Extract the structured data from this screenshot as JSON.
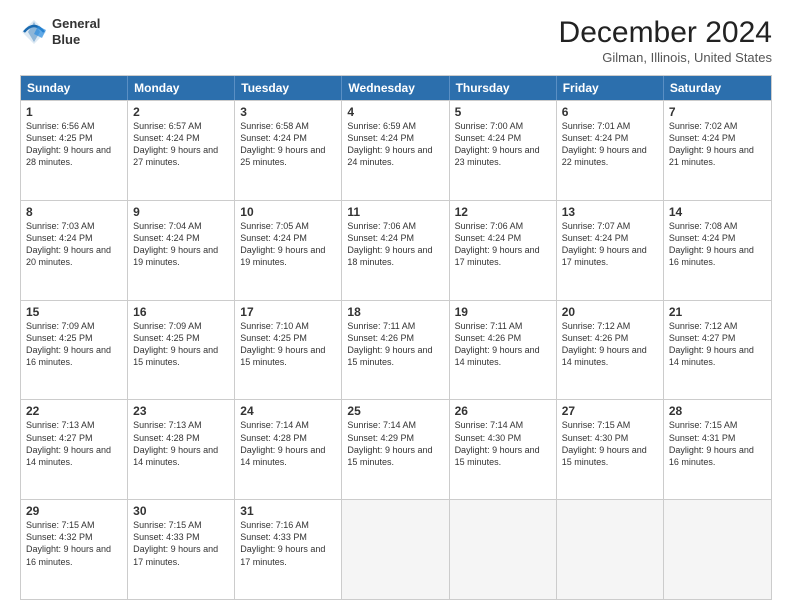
{
  "logo": {
    "line1": "General",
    "line2": "Blue"
  },
  "title": "December 2024",
  "subtitle": "Gilman, Illinois, United States",
  "days": [
    "Sunday",
    "Monday",
    "Tuesday",
    "Wednesday",
    "Thursday",
    "Friday",
    "Saturday"
  ],
  "rows": [
    [
      {
        "num": "1",
        "text": "Sunrise: 6:56 AM\nSunset: 4:25 PM\nDaylight: 9 hours and 28 minutes."
      },
      {
        "num": "2",
        "text": "Sunrise: 6:57 AM\nSunset: 4:24 PM\nDaylight: 9 hours and 27 minutes."
      },
      {
        "num": "3",
        "text": "Sunrise: 6:58 AM\nSunset: 4:24 PM\nDaylight: 9 hours and 25 minutes."
      },
      {
        "num": "4",
        "text": "Sunrise: 6:59 AM\nSunset: 4:24 PM\nDaylight: 9 hours and 24 minutes."
      },
      {
        "num": "5",
        "text": "Sunrise: 7:00 AM\nSunset: 4:24 PM\nDaylight: 9 hours and 23 minutes."
      },
      {
        "num": "6",
        "text": "Sunrise: 7:01 AM\nSunset: 4:24 PM\nDaylight: 9 hours and 22 minutes."
      },
      {
        "num": "7",
        "text": "Sunrise: 7:02 AM\nSunset: 4:24 PM\nDaylight: 9 hours and 21 minutes."
      }
    ],
    [
      {
        "num": "8",
        "text": "Sunrise: 7:03 AM\nSunset: 4:24 PM\nDaylight: 9 hours and 20 minutes."
      },
      {
        "num": "9",
        "text": "Sunrise: 7:04 AM\nSunset: 4:24 PM\nDaylight: 9 hours and 19 minutes."
      },
      {
        "num": "10",
        "text": "Sunrise: 7:05 AM\nSunset: 4:24 PM\nDaylight: 9 hours and 19 minutes."
      },
      {
        "num": "11",
        "text": "Sunrise: 7:06 AM\nSunset: 4:24 PM\nDaylight: 9 hours and 18 minutes."
      },
      {
        "num": "12",
        "text": "Sunrise: 7:06 AM\nSunset: 4:24 PM\nDaylight: 9 hours and 17 minutes."
      },
      {
        "num": "13",
        "text": "Sunrise: 7:07 AM\nSunset: 4:24 PM\nDaylight: 9 hours and 17 minutes."
      },
      {
        "num": "14",
        "text": "Sunrise: 7:08 AM\nSunset: 4:24 PM\nDaylight: 9 hours and 16 minutes."
      }
    ],
    [
      {
        "num": "15",
        "text": "Sunrise: 7:09 AM\nSunset: 4:25 PM\nDaylight: 9 hours and 16 minutes."
      },
      {
        "num": "16",
        "text": "Sunrise: 7:09 AM\nSunset: 4:25 PM\nDaylight: 9 hours and 15 minutes."
      },
      {
        "num": "17",
        "text": "Sunrise: 7:10 AM\nSunset: 4:25 PM\nDaylight: 9 hours and 15 minutes."
      },
      {
        "num": "18",
        "text": "Sunrise: 7:11 AM\nSunset: 4:26 PM\nDaylight: 9 hours and 15 minutes."
      },
      {
        "num": "19",
        "text": "Sunrise: 7:11 AM\nSunset: 4:26 PM\nDaylight: 9 hours and 14 minutes."
      },
      {
        "num": "20",
        "text": "Sunrise: 7:12 AM\nSunset: 4:26 PM\nDaylight: 9 hours and 14 minutes."
      },
      {
        "num": "21",
        "text": "Sunrise: 7:12 AM\nSunset: 4:27 PM\nDaylight: 9 hours and 14 minutes."
      }
    ],
    [
      {
        "num": "22",
        "text": "Sunrise: 7:13 AM\nSunset: 4:27 PM\nDaylight: 9 hours and 14 minutes."
      },
      {
        "num": "23",
        "text": "Sunrise: 7:13 AM\nSunset: 4:28 PM\nDaylight: 9 hours and 14 minutes."
      },
      {
        "num": "24",
        "text": "Sunrise: 7:14 AM\nSunset: 4:28 PM\nDaylight: 9 hours and 14 minutes."
      },
      {
        "num": "25",
        "text": "Sunrise: 7:14 AM\nSunset: 4:29 PM\nDaylight: 9 hours and 15 minutes."
      },
      {
        "num": "26",
        "text": "Sunrise: 7:14 AM\nSunset: 4:30 PM\nDaylight: 9 hours and 15 minutes."
      },
      {
        "num": "27",
        "text": "Sunrise: 7:15 AM\nSunset: 4:30 PM\nDaylight: 9 hours and 15 minutes."
      },
      {
        "num": "28",
        "text": "Sunrise: 7:15 AM\nSunset: 4:31 PM\nDaylight: 9 hours and 16 minutes."
      }
    ],
    [
      {
        "num": "29",
        "text": "Sunrise: 7:15 AM\nSunset: 4:32 PM\nDaylight: 9 hours and 16 minutes."
      },
      {
        "num": "30",
        "text": "Sunrise: 7:15 AM\nSunset: 4:33 PM\nDaylight: 9 hours and 17 minutes."
      },
      {
        "num": "31",
        "text": "Sunrise: 7:16 AM\nSunset: 4:33 PM\nDaylight: 9 hours and 17 minutes."
      },
      {
        "num": "",
        "text": ""
      },
      {
        "num": "",
        "text": ""
      },
      {
        "num": "",
        "text": ""
      },
      {
        "num": "",
        "text": ""
      }
    ]
  ]
}
